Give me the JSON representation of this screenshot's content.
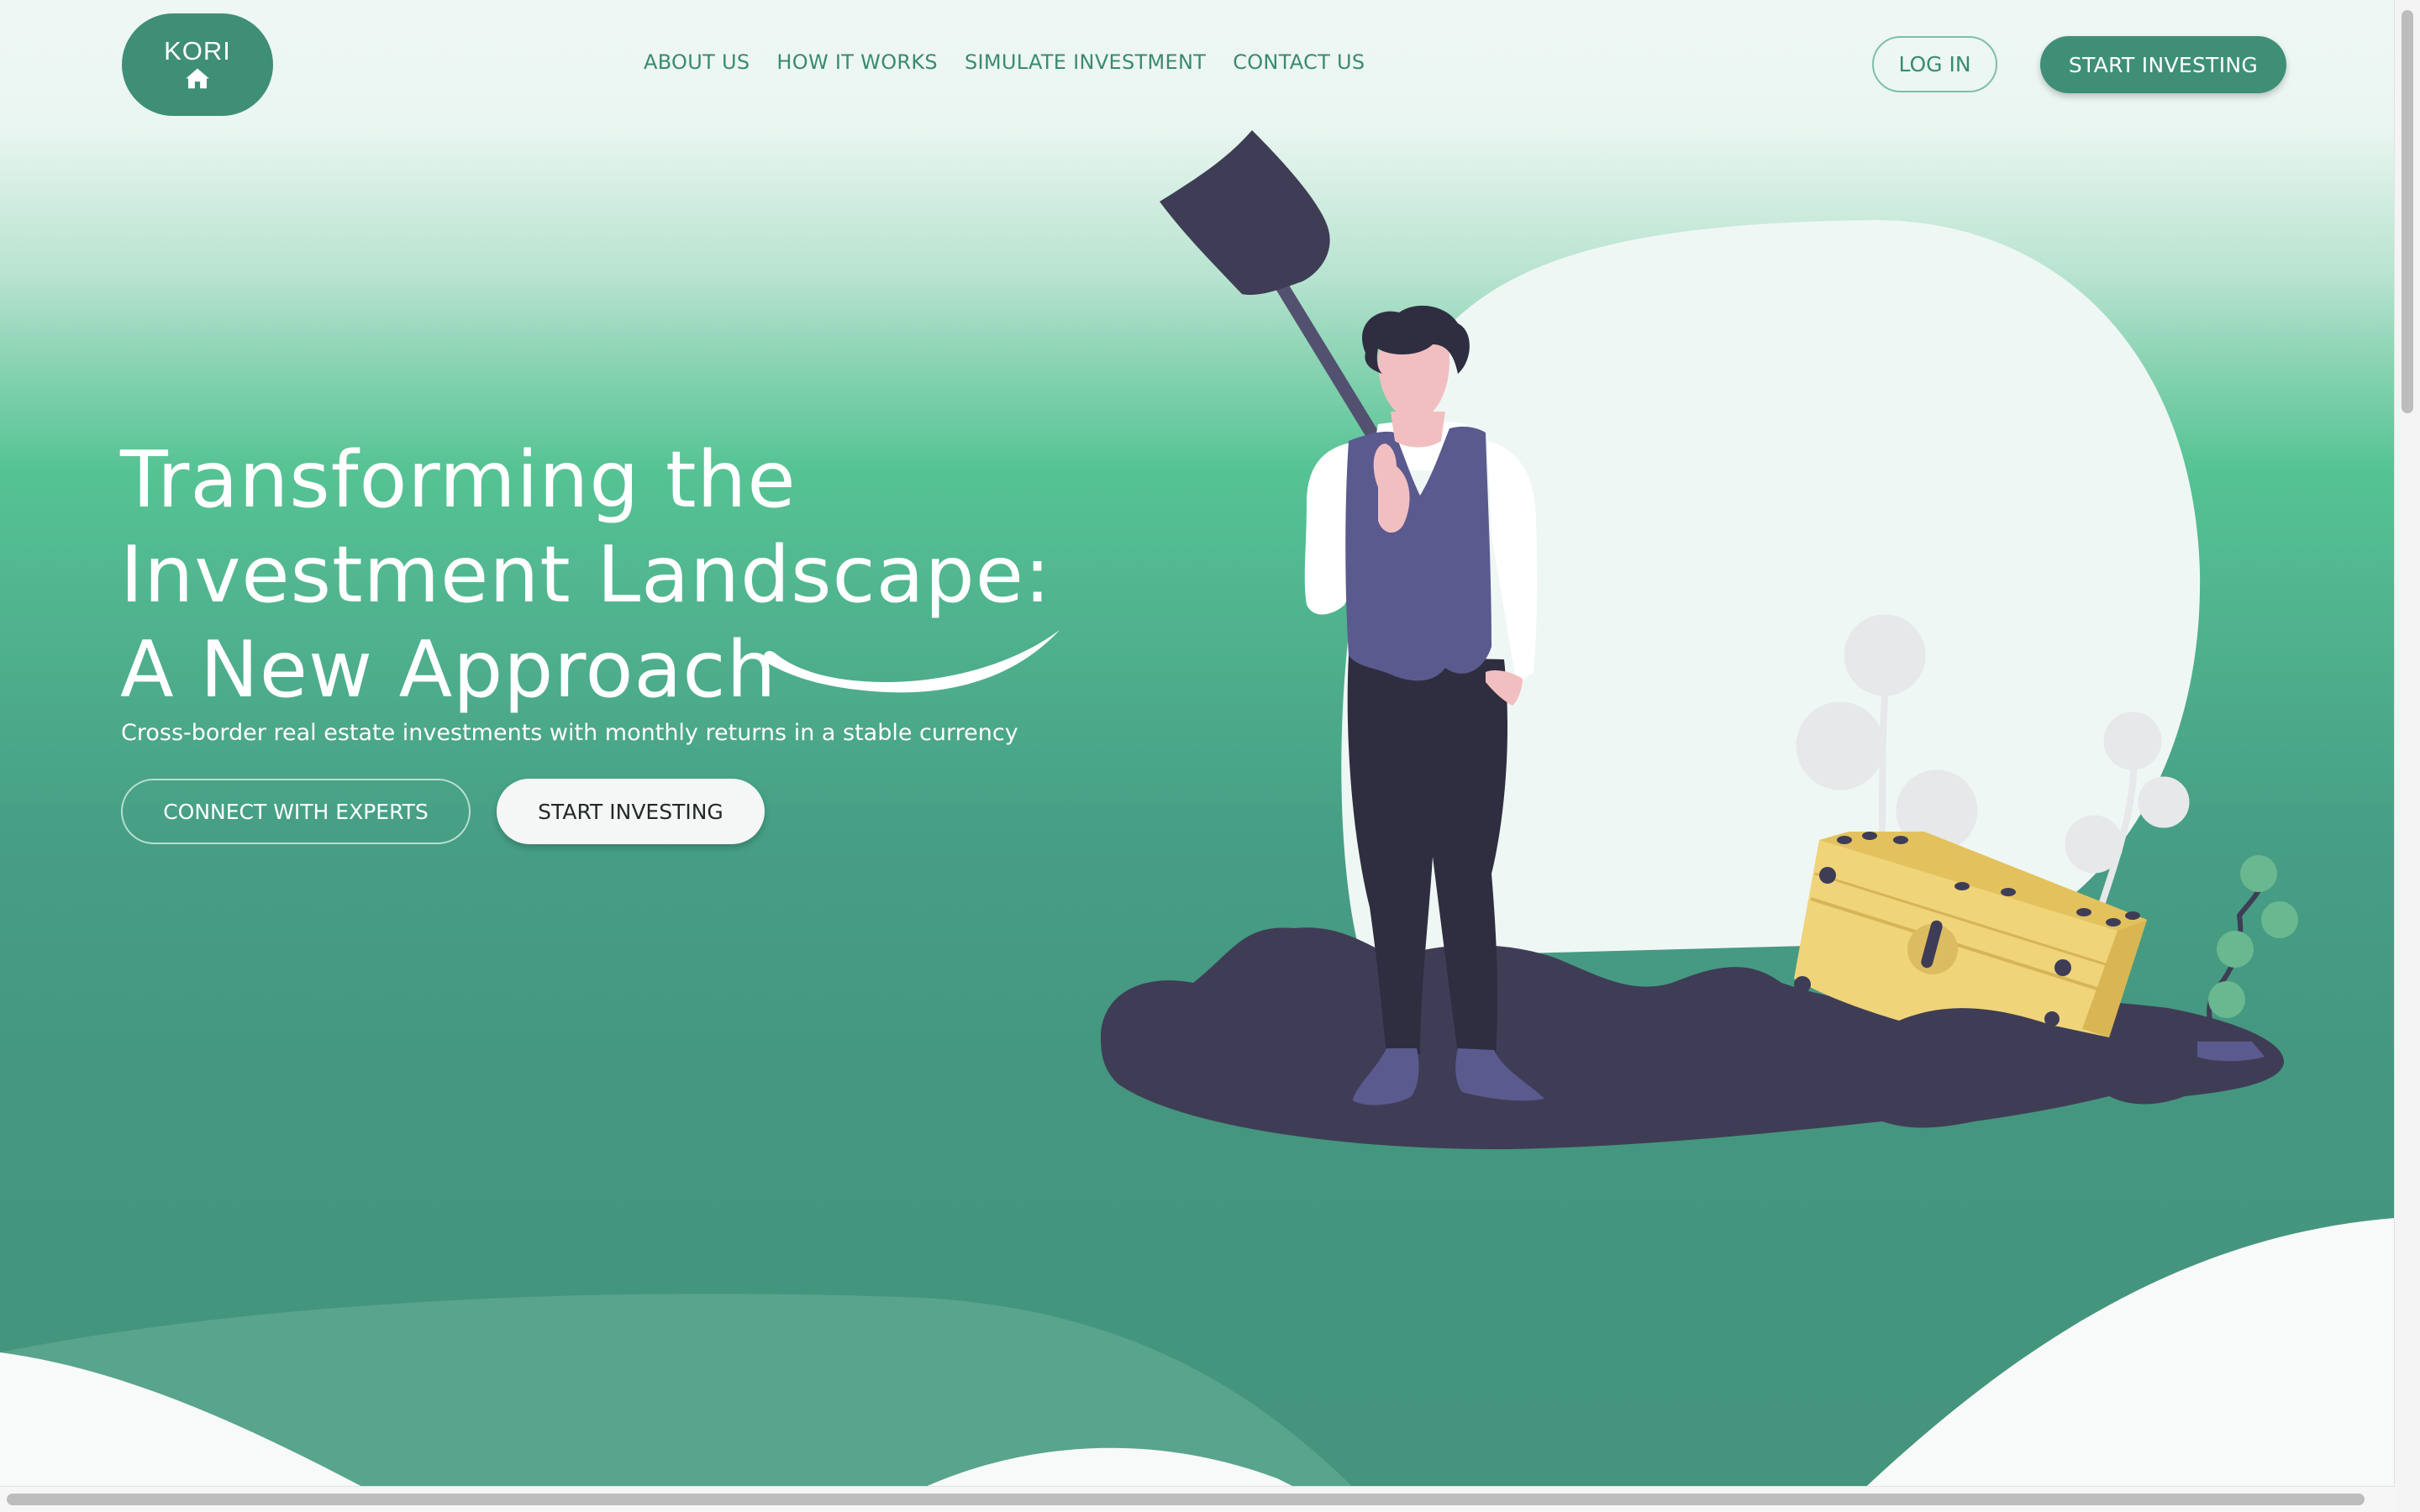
{
  "brand": {
    "name": "KORI",
    "icon": "home-icon"
  },
  "nav": {
    "items": [
      {
        "label": "ABOUT US"
      },
      {
        "label": "HOW IT WORKS"
      },
      {
        "label": "SIMULATE INVESTMENT"
      },
      {
        "label": "CONTACT US"
      }
    ]
  },
  "header": {
    "login_label": "LOG IN",
    "start_label": "START INVESTING"
  },
  "hero": {
    "title_lines": [
      "Transforming the",
      "Investment Landscape:",
      "A New Approach"
    ],
    "subtitle": "Cross-border real estate investments with monthly returns in a stable currency",
    "connect_label": "CONNECT WITH EXPERTS",
    "start_label": "START INVESTING"
  },
  "colors": {
    "brand_green": "#3f8f77",
    "nav_text": "#3a8a72",
    "hero_green": "#55c394",
    "deep_green": "#44947e",
    "illustration_dark": "#3f3d56",
    "vest_purple": "#5b5a8f",
    "chest_gold": "#f0d47a",
    "skin": "#f2bfc0"
  }
}
